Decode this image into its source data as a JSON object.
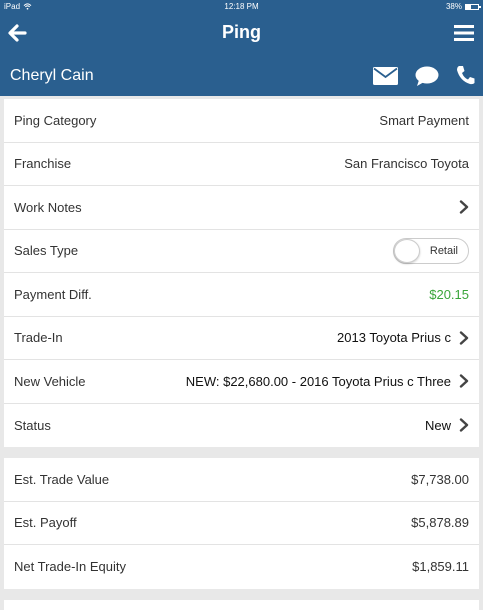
{
  "statusbar": {
    "device": "iPad",
    "time": "12:18 PM",
    "battery": "38%",
    "battery_level": 0.38
  },
  "navbar": {
    "title": "Ping",
    "back_icon": "arrow-left-icon",
    "menu_icon": "hamburger-menu-icon"
  },
  "subheader": {
    "name": "Cheryl Cain",
    "icons": [
      "envelope-icon",
      "chat-bubble-icon",
      "phone-icon"
    ]
  },
  "details": {
    "ping_category": {
      "label": "Ping Category",
      "value": "Smart Payment"
    },
    "franchise": {
      "label": "Franchise",
      "value": "San Francisco Toyota"
    },
    "work_notes": {
      "label": "Work Notes"
    },
    "sales_type": {
      "label": "Sales Type",
      "value": "Retail",
      "toggled": false
    },
    "payment_diff": {
      "label": "Payment Diff.",
      "value": "$20.15",
      "value_color": "#3aa53a"
    },
    "trade_in": {
      "label": "Trade-In",
      "value": "2013 Toyota Prius c"
    },
    "new_vehicle": {
      "label": "New Vehicle",
      "value": "NEW: $22,680.00 - 2016 Toyota Prius c Three"
    },
    "status": {
      "label": "Status",
      "value": "New"
    }
  },
  "trade": {
    "est_trade_value": {
      "label": "Est. Trade Value",
      "value": "$7,738.00"
    },
    "est_payoff": {
      "label": "Est. Payoff",
      "value": "$5,878.89"
    },
    "net_trade_in_equity": {
      "label": "Net Trade-In Equity",
      "value": "$1,859.11"
    }
  },
  "colors": {
    "header": "#2a5f8f",
    "background": "#e8e8e8",
    "positive": "#3aa53a"
  }
}
